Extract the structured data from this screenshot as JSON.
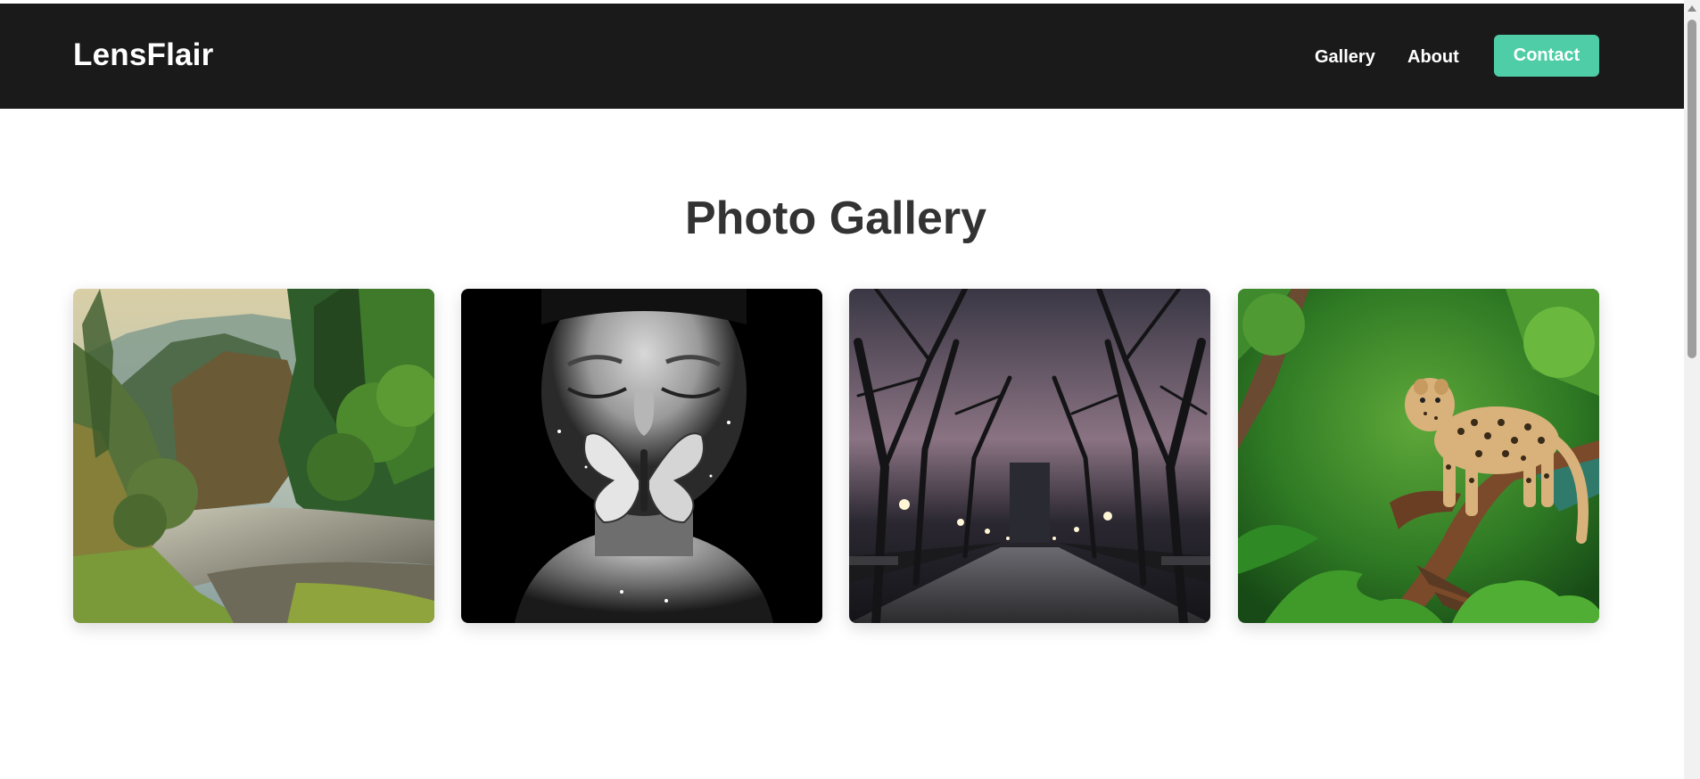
{
  "header": {
    "brand": "LensFlair",
    "nav": [
      {
        "label": "Gallery"
      },
      {
        "label": "About"
      }
    ],
    "contact_label": "Contact"
  },
  "main": {
    "title": "Photo Gallery",
    "photos": [
      {
        "subject": "forest river valley"
      },
      {
        "subject": "monochrome portrait with butterfly"
      },
      {
        "subject": "tree-lined park path at night"
      },
      {
        "subject": "leopard on branch in jungle"
      }
    ]
  },
  "colors": {
    "navbar": "#1a1a1a",
    "accent": "#4ecda6",
    "title_text": "#333333",
    "background": "#ffffff"
  }
}
